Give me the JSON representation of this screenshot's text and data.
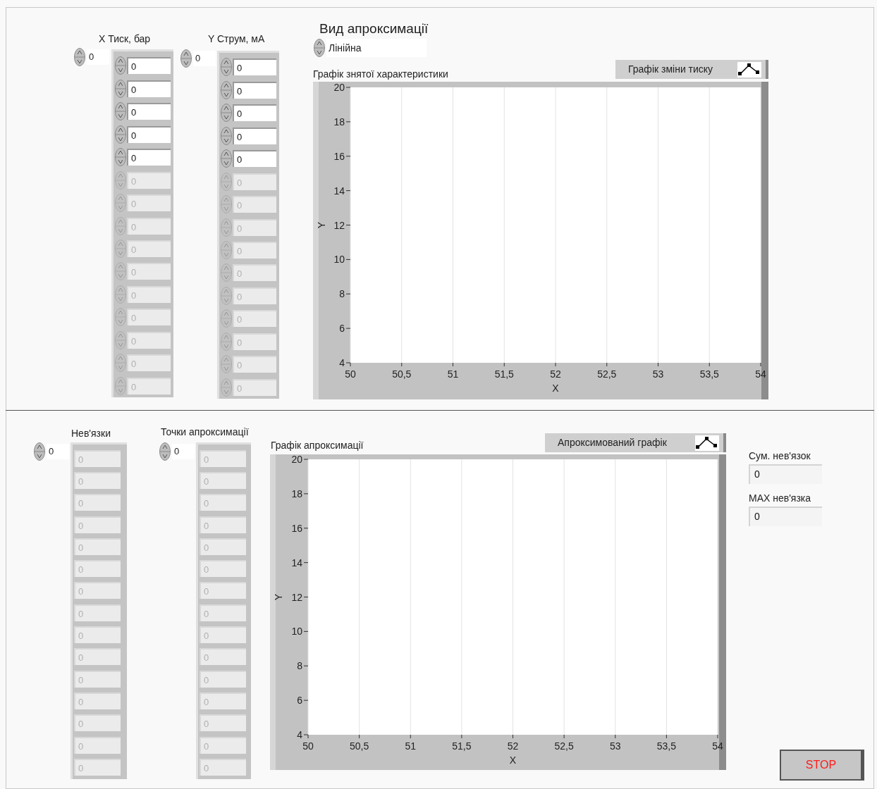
{
  "x_array": {
    "label": "X Тиск, бар",
    "index": "0",
    "items": [
      {
        "value": "0",
        "disabled": false
      },
      {
        "value": "0",
        "disabled": false
      },
      {
        "value": "0",
        "disabled": false
      },
      {
        "value": "0",
        "disabled": false
      },
      {
        "value": "0",
        "disabled": false
      },
      {
        "value": "0",
        "disabled": true
      },
      {
        "value": "0",
        "disabled": true
      },
      {
        "value": "0",
        "disabled": true
      },
      {
        "value": "0",
        "disabled": true
      },
      {
        "value": "0",
        "disabled": true
      },
      {
        "value": "0",
        "disabled": true
      },
      {
        "value": "0",
        "disabled": true
      },
      {
        "value": "0",
        "disabled": true
      },
      {
        "value": "0",
        "disabled": true
      },
      {
        "value": "0",
        "disabled": true
      }
    ]
  },
  "y_array": {
    "label": "Y Струм, мА",
    "index": "0",
    "items": [
      {
        "value": "0",
        "disabled": false
      },
      {
        "value": "0",
        "disabled": false
      },
      {
        "value": "0",
        "disabled": false
      },
      {
        "value": "0",
        "disabled": false
      },
      {
        "value": "0",
        "disabled": false
      },
      {
        "value": "0",
        "disabled": true
      },
      {
        "value": "0",
        "disabled": true
      },
      {
        "value": "0",
        "disabled": true
      },
      {
        "value": "0",
        "disabled": true
      },
      {
        "value": "0",
        "disabled": true
      },
      {
        "value": "0",
        "disabled": true
      },
      {
        "value": "0",
        "disabled": true
      },
      {
        "value": "0",
        "disabled": true
      },
      {
        "value": "0",
        "disabled": true
      },
      {
        "value": "0",
        "disabled": true
      }
    ]
  },
  "approximation_type": {
    "label": "Вид апроксимації",
    "value": "Лінійна"
  },
  "measured_graph": {
    "legend": "Графік зміни тиску",
    "chart_data": {
      "type": "line",
      "grid": true,
      "title": "Графік знятої характеристики",
      "xlabel": "X",
      "ylabel": "Y",
      "xlim": [
        50,
        54
      ],
      "ylim": [
        4,
        20
      ],
      "xticks": [
        {
          "value": 50,
          "label": "50"
        },
        {
          "value": 50.5,
          "label": "50,5"
        },
        {
          "value": 51,
          "label": "51"
        },
        {
          "value": 51.5,
          "label": "51,5"
        },
        {
          "value": 52,
          "label": "52"
        },
        {
          "value": 52.5,
          "label": "52,5"
        },
        {
          "value": 53,
          "label": "53"
        },
        {
          "value": 53.5,
          "label": "53,5"
        },
        {
          "value": 54,
          "label": "54"
        }
      ],
      "yticks": [
        4,
        6,
        8,
        10,
        12,
        14,
        16,
        18,
        20
      ]
    }
  },
  "residuals": {
    "label": "Нев'язки",
    "index": "0",
    "items": [
      {
        "value": "0",
        "disabled": true
      },
      {
        "value": "0",
        "disabled": true
      },
      {
        "value": "0",
        "disabled": true
      },
      {
        "value": "0",
        "disabled": true
      },
      {
        "value": "0",
        "disabled": true
      },
      {
        "value": "0",
        "disabled": true
      },
      {
        "value": "0",
        "disabled": true
      },
      {
        "value": "0",
        "disabled": true
      },
      {
        "value": "0",
        "disabled": true
      },
      {
        "value": "0",
        "disabled": true
      },
      {
        "value": "0",
        "disabled": true
      },
      {
        "value": "0",
        "disabled": true
      },
      {
        "value": "0",
        "disabled": true
      },
      {
        "value": "0",
        "disabled": true
      },
      {
        "value": "0",
        "disabled": true
      }
    ]
  },
  "approximation_points": {
    "label": "Точки апроксимації",
    "index": "0",
    "items": [
      {
        "value": "0",
        "disabled": true
      },
      {
        "value": "0",
        "disabled": true
      },
      {
        "value": "0",
        "disabled": true
      },
      {
        "value": "0",
        "disabled": true
      },
      {
        "value": "0",
        "disabled": true
      },
      {
        "value": "0",
        "disabled": true
      },
      {
        "value": "0",
        "disabled": true
      },
      {
        "value": "0",
        "disabled": true
      },
      {
        "value": "0",
        "disabled": true
      },
      {
        "value": "0",
        "disabled": true
      },
      {
        "value": "0",
        "disabled": true
      },
      {
        "value": "0",
        "disabled": true
      },
      {
        "value": "0",
        "disabled": true
      },
      {
        "value": "0",
        "disabled": true
      },
      {
        "value": "0",
        "disabled": true
      }
    ]
  },
  "approximated_graph": {
    "legend": "Апроксимований графік",
    "chart_data": {
      "type": "line",
      "grid": true,
      "title": "Графік апроксимації",
      "xlabel": "X",
      "ylabel": "Y",
      "xlim": [
        50,
        54
      ],
      "ylim": [
        4,
        20
      ],
      "xticks": [
        {
          "value": 50,
          "label": "50"
        },
        {
          "value": 50.5,
          "label": "50,5"
        },
        {
          "value": 51,
          "label": "51"
        },
        {
          "value": 51.5,
          "label": "51,5"
        },
        {
          "value": 52,
          "label": "52"
        },
        {
          "value": 52.5,
          "label": "52,5"
        },
        {
          "value": 53,
          "label": "53"
        },
        {
          "value": 53.5,
          "label": "53,5"
        },
        {
          "value": 54,
          "label": "54"
        }
      ],
      "yticks": [
        4,
        6,
        8,
        10,
        12,
        14,
        16,
        18,
        20
      ]
    }
  },
  "residual_sum": {
    "label": "Сум. нев'язок",
    "value": "0"
  },
  "max_residual": {
    "label": "MAX нев'язка",
    "value": "0"
  },
  "stop_button": {
    "label": "STOP"
  }
}
